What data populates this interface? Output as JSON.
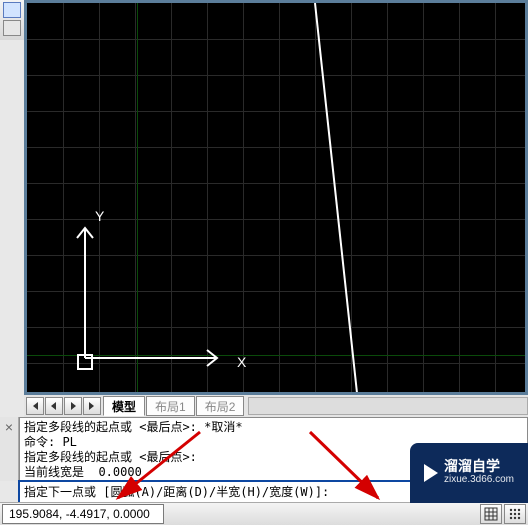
{
  "canvas": {
    "axis_x_label": "X",
    "axis_y_label": "Y"
  },
  "tabs": {
    "nav_first_icon": "nav-first",
    "nav_prev_icon": "nav-prev",
    "nav_next_icon": "nav-next",
    "nav_last_icon": "nav-last",
    "items": [
      {
        "label": "模型",
        "active": true
      },
      {
        "label": "布局1",
        "active": false
      },
      {
        "label": "布局2",
        "active": false
      }
    ]
  },
  "command_history": {
    "lines": [
      "指定多段线的起点或 <最后点>: *取消*",
      "命令: PL",
      "指定多段线的起点或 <最后点>:",
      "当前线宽是  0.0000"
    ]
  },
  "command_input": {
    "text": "指定下一点或 [圆弧(A)/距离(D)/半宽(H)/宽度(W)]:",
    "icon": "pencil-icon"
  },
  "status": {
    "coords": "195.9084, -4.4917, 0.0000",
    "buttons": [
      {
        "name": "grid-icon"
      },
      {
        "name": "snap-icon"
      }
    ]
  },
  "logo": {
    "cn": "溜溜自学",
    "en": "zixue.3d66.com"
  }
}
